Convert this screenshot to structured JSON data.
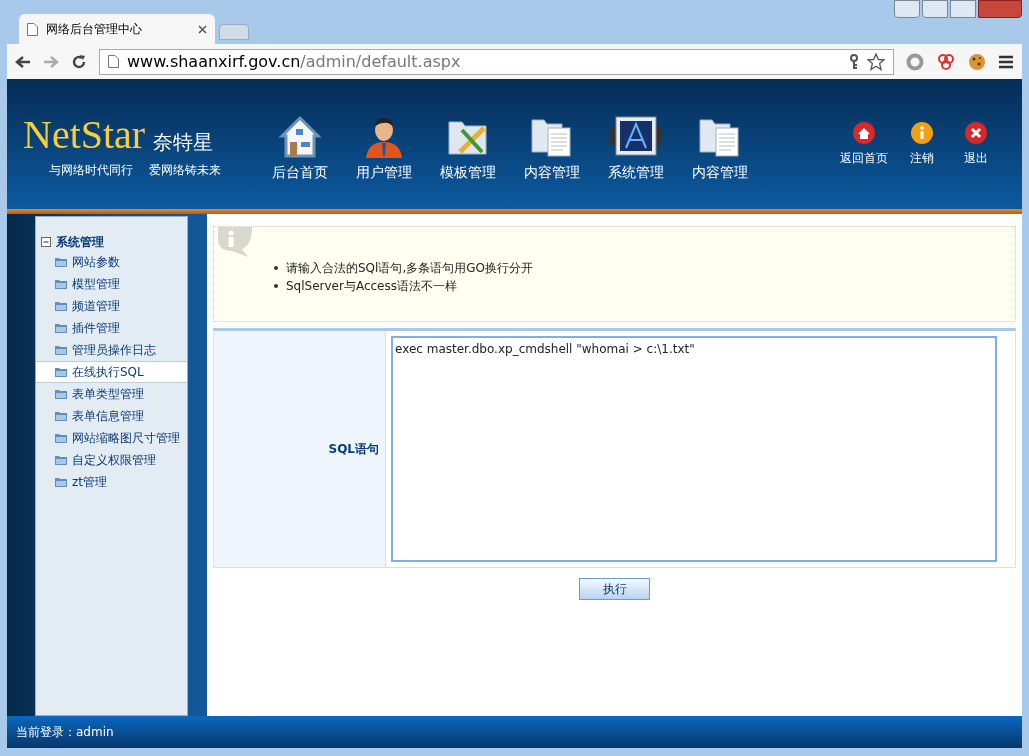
{
  "browser": {
    "tabs": [
      {
        "title": "网络后台管理中心",
        "selected": true
      }
    ],
    "address": {
      "host": "www.shaanxirf.gov.cn",
      "path": "/admin/default.aspx"
    }
  },
  "header": {
    "logo": "NetStar",
    "logo_cn": "奈特星",
    "slogans": [
      "与网络时代同行",
      "爱网络铸未来"
    ],
    "nav": [
      {
        "label": "后台首页",
        "kind": "house"
      },
      {
        "label": "用户管理",
        "kind": "user"
      },
      {
        "label": "模板管理",
        "kind": "template"
      },
      {
        "label": "内容管理",
        "kind": "folder"
      },
      {
        "label": "系统管理",
        "kind": "system"
      },
      {
        "label": "内容管理",
        "kind": "folder"
      }
    ],
    "actions": [
      {
        "label": "返回首页",
        "kind": "home"
      },
      {
        "label": "注销",
        "kind": "info"
      },
      {
        "label": "退出",
        "kind": "close"
      }
    ]
  },
  "sidebar": {
    "group": {
      "label": "系统管理",
      "expanded": true,
      "children": [
        {
          "label": "网站参数",
          "selected": false
        },
        {
          "label": "模型管理",
          "selected": false
        },
        {
          "label": "频道管理",
          "selected": false
        },
        {
          "label": "插件管理",
          "selected": false
        },
        {
          "label": "管理员操作日志",
          "selected": false
        },
        {
          "label": "在线执行SQL",
          "selected": true
        },
        {
          "label": "表单类型管理",
          "selected": false
        },
        {
          "label": "表单信息管理",
          "selected": false
        },
        {
          "label": "网站缩略图尺寸管理",
          "selected": false
        },
        {
          "label": "自定义权限管理",
          "selected": false
        },
        {
          "label": "zt管理",
          "selected": false
        }
      ]
    }
  },
  "notice": {
    "items": [
      "请输入合法的SQl语句,多条语句用GO换行分开",
      "SqlServer与Access语法不一样"
    ]
  },
  "form": {
    "label": "SQL语句",
    "value": "exec master.dbo.xp_cmdshell \"whomai > c:\\1.txt\"",
    "submit": "执行"
  },
  "status_bar": {
    "text": "当前登录：admin"
  }
}
